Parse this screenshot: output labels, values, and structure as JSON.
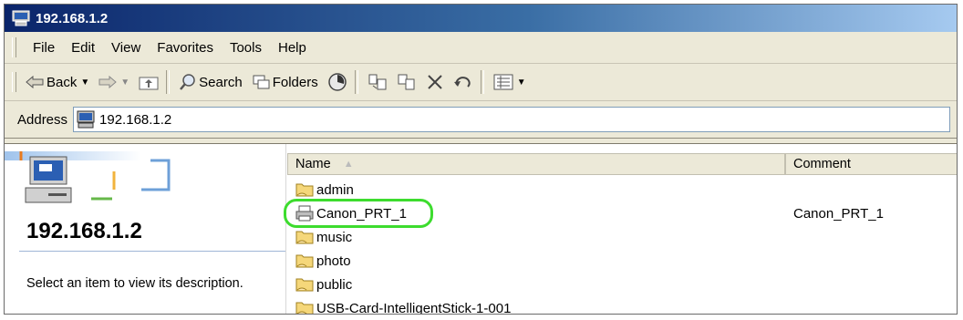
{
  "window": {
    "title": "192.168.1.2"
  },
  "menu": [
    "File",
    "Edit",
    "View",
    "Favorites",
    "Tools",
    "Help"
  ],
  "toolbar": {
    "back": "Back",
    "search": "Search",
    "folders": "Folders"
  },
  "address": {
    "label": "Address",
    "value": "192.168.1.2"
  },
  "left_pane": {
    "title": "192.168.1.2",
    "description": "Select an item to view its description."
  },
  "list": {
    "columns": {
      "name": "Name",
      "comment": "Comment"
    },
    "rows": [
      {
        "name": "admin",
        "comment": "",
        "icon": "shared-folder-icon"
      },
      {
        "name": "Canon_PRT_1",
        "comment": "Canon_PRT_1",
        "icon": "printer-icon",
        "highlighted": true
      },
      {
        "name": "music",
        "comment": "",
        "icon": "shared-folder-icon"
      },
      {
        "name": "photo",
        "comment": "",
        "icon": "shared-folder-icon"
      },
      {
        "name": "public",
        "comment": "",
        "icon": "shared-folder-icon"
      },
      {
        "name": "USB-Card-IntelligentStick-1-001",
        "comment": "",
        "icon": "shared-folder-icon"
      }
    ]
  },
  "colors": {
    "title_bar": "#0a246a",
    "highlight": "#3ddc2e"
  }
}
